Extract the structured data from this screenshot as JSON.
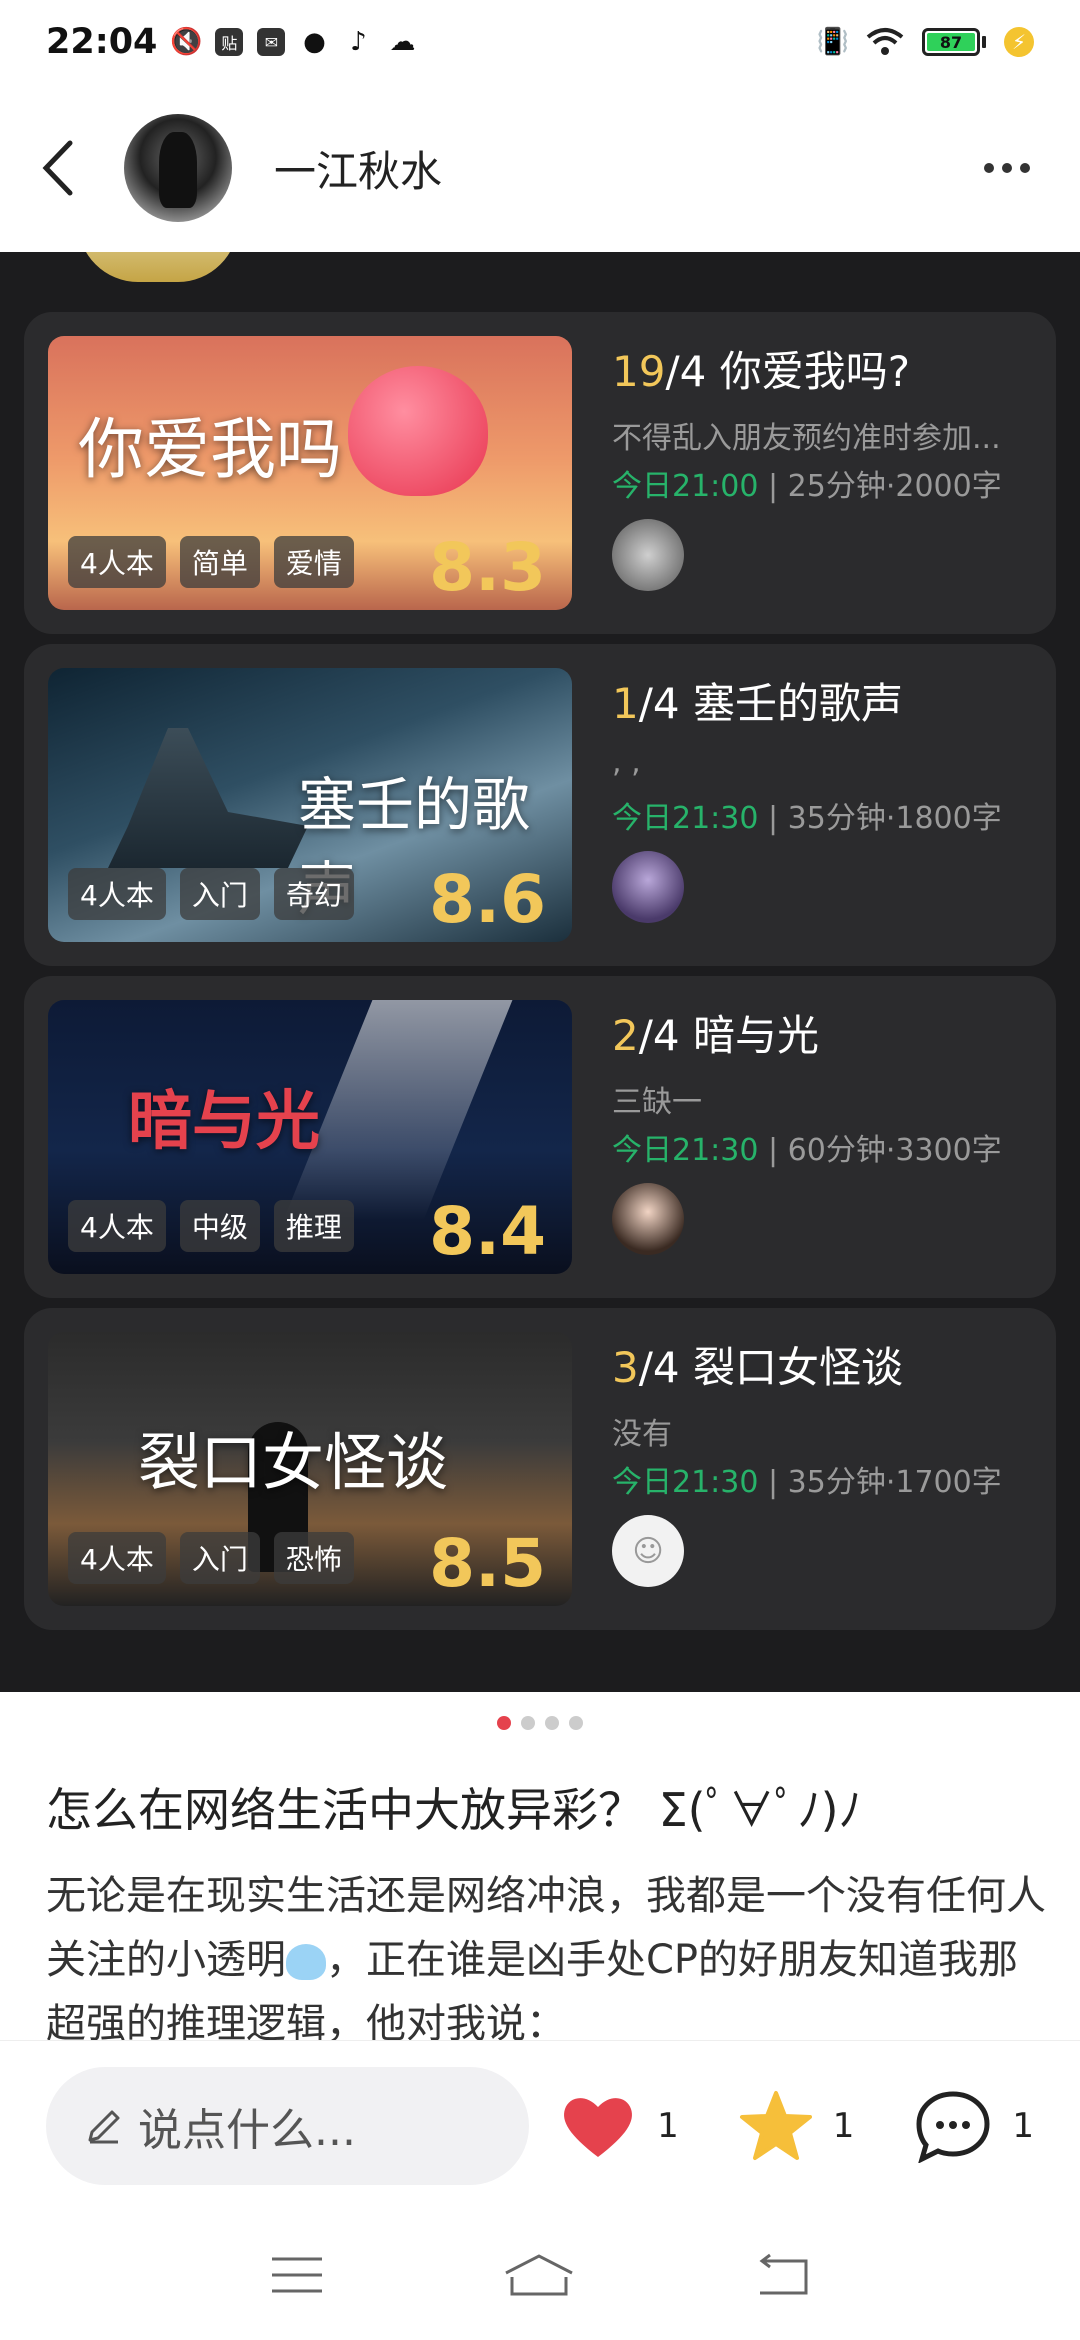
{
  "status_bar": {
    "time": "22:04",
    "battery": "87"
  },
  "header": {
    "username": "一江秋水"
  },
  "cards": [
    {
      "cover_title": "你爱我吗",
      "tags": [
        "4人本",
        "简单",
        "爱情"
      ],
      "score": "8.3",
      "count": "19",
      "capacity": "/4",
      "title": "你爱我吗?",
      "desc": "不得乱入朋友预约准时参加...",
      "time": "今日21:00",
      "meta": " | 25分钟·2000字"
    },
    {
      "cover_title": "塞壬的歌声",
      "tags": [
        "4人本",
        "入门",
        "奇幻"
      ],
      "score": "8.6",
      "count": "1",
      "capacity": "/4",
      "title": "塞壬的歌声",
      "desc": ", ,",
      "time": "今日21:30",
      "meta": " | 35分钟·1800字"
    },
    {
      "cover_title": "暗与光",
      "tags": [
        "4人本",
        "中级",
        "推理"
      ],
      "score": "8.4",
      "count": "2",
      "capacity": "/4",
      "title": "暗与光",
      "desc": "三缺一",
      "time": "今日21:30",
      "meta": " | 60分钟·3300字"
    },
    {
      "cover_title": "裂口女怪谈",
      "tags": [
        "4人本",
        "入门",
        "恐怖"
      ],
      "score": "8.5",
      "count": "3",
      "capacity": "/4",
      "title": "裂口女怪谈",
      "desc": "没有",
      "time": "今日21:30",
      "meta": " | 35分钟·1700字"
    }
  ],
  "article": {
    "title": "怎么在网络生活中大放异彩？ Σ(ﾟ∀ﾟﾉ)ﾉ",
    "body_1": "无论是在现实生活还是网络冲浪，我都是一个没有任何人关注的小透明",
    "body_2": "，正在谁是凶手处CP的好朋友知道我那超强的推理逻辑，他对我说："
  },
  "action_bar": {
    "placeholder": "说点什么...",
    "likes": "1",
    "stars": "1",
    "comments": "1"
  },
  "colors": {
    "accent_gold": "#f2c75a",
    "time_green": "#27b36a",
    "like_red": "#e5424d",
    "star_yellow": "#f6bf3a"
  }
}
